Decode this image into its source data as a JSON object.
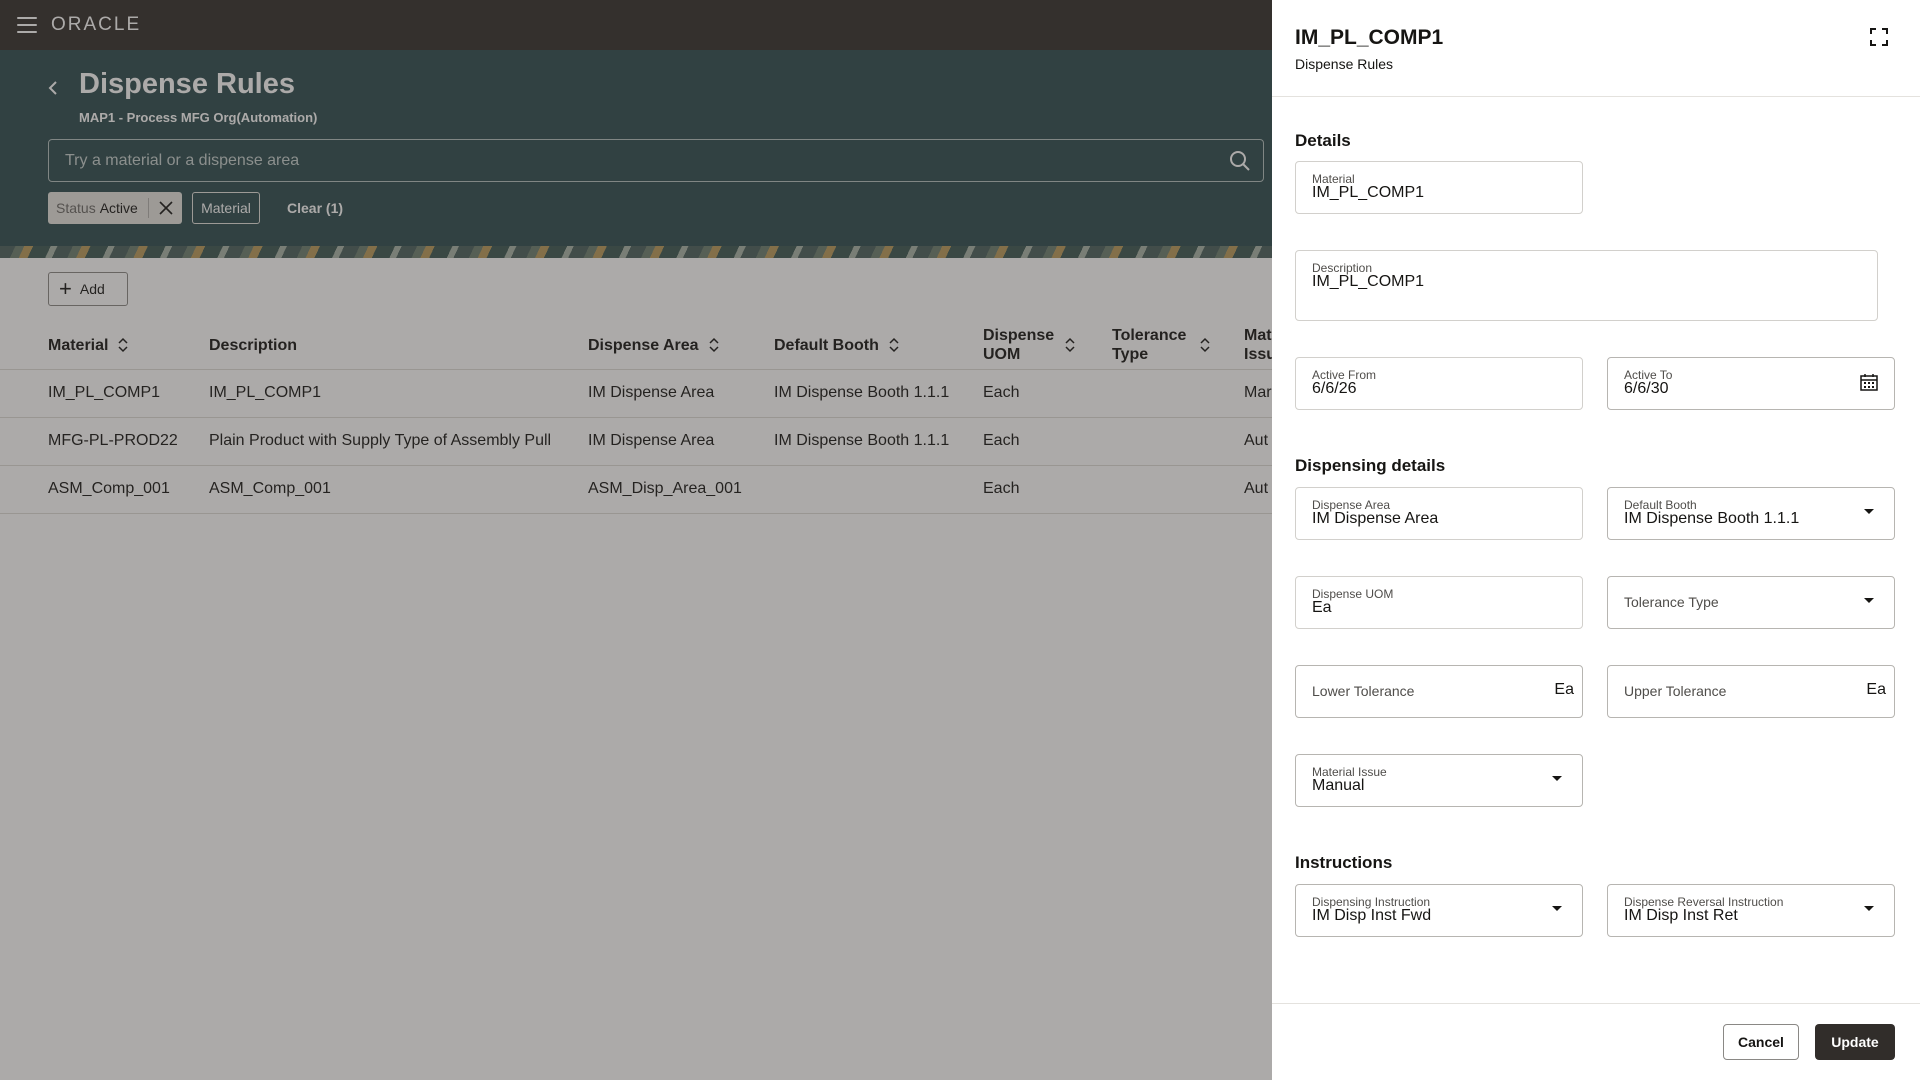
{
  "header": {
    "logo": "ORACLE",
    "page_title": "Dispense Rules",
    "page_subtitle": "MAP1 - Process MFG Org(Automation)",
    "search_placeholder": "Try a material or a dispense area"
  },
  "filters": {
    "status_label": "Status",
    "status_value": "Active",
    "material_chip": "Material",
    "clear_label": "Clear (1)"
  },
  "toolbar": {
    "add_label": "Add"
  },
  "table": {
    "columns": [
      {
        "label": "Material",
        "sortable": true
      },
      {
        "label": "Description",
        "sortable": false
      },
      {
        "label": "Dispense Area",
        "sortable": true
      },
      {
        "label": "Default Booth",
        "sortable": true
      },
      {
        "label": "Dispense UOM",
        "sortable": true
      },
      {
        "label": "Tolerance Type",
        "sortable": true
      },
      {
        "label": "Mat Issu",
        "sortable": false
      }
    ],
    "rows": [
      [
        "IM_PL_COMP1",
        "IM_PL_COMP1",
        "IM Dispense Area",
        "IM Dispense Booth 1.1.1",
        "Each",
        "",
        "Mar"
      ],
      [
        "MFG-PL-PROD22",
        "Plain Product with Supply Type of Assembly Pull",
        "IM Dispense Area",
        "IM Dispense Booth 1.1.1",
        "Each",
        "",
        "Aut"
      ],
      [
        "ASM_Comp_001",
        "ASM_Comp_001",
        "ASM_Disp_Area_001",
        "",
        "Each",
        "",
        "Aut"
      ]
    ]
  },
  "drawer": {
    "title": "IM_PL_COMP1",
    "subtitle": "Dispense Rules",
    "sections": {
      "details": "Details",
      "dispensing": "Dispensing details",
      "instructions": "Instructions"
    },
    "fields": {
      "material": {
        "label": "Material",
        "value": "IM_PL_COMP1"
      },
      "description": {
        "label": "Description",
        "value": "IM_PL_COMP1"
      },
      "active_from": {
        "label": "Active From",
        "value": "6/6/26"
      },
      "active_to": {
        "label": "Active To",
        "value": "6/6/30"
      },
      "dispense_area": {
        "label": "Dispense Area",
        "value": "IM Dispense Area"
      },
      "default_booth": {
        "label": "Default Booth",
        "value": "IM Dispense Booth 1.1.1"
      },
      "dispense_uom": {
        "label": "Dispense UOM",
        "value": "Ea"
      },
      "tolerance_type": {
        "label": "Tolerance Type",
        "value": ""
      },
      "lower_tolerance": {
        "label": "Lower Tolerance",
        "unit": "Ea"
      },
      "upper_tolerance": {
        "label": "Upper Tolerance",
        "unit": "Ea"
      },
      "material_issue": {
        "label": "Material Issue",
        "value": "Manual"
      },
      "dispensing_instruction": {
        "label": "Dispensing Instruction",
        "value": "IM Disp Inst Fwd"
      },
      "dispense_reversal_instruction": {
        "label": "Dispense Reversal Instruction",
        "value": "IM Disp Inst Ret"
      }
    },
    "buttons": {
      "cancel": "Cancel",
      "update": "Update"
    }
  },
  "colors": {
    "top_bar": "#312d2a",
    "header_band": "#2b4a4e",
    "primary_button": "#312d2a"
  }
}
